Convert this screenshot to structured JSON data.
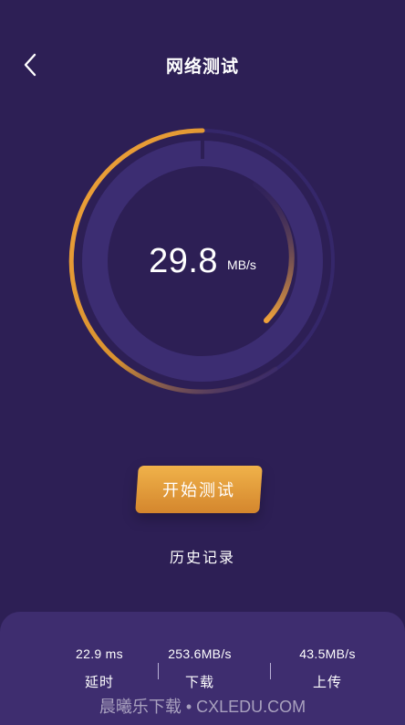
{
  "header": {
    "title": "网络测试",
    "back_icon": "chevron-left-icon"
  },
  "gauge": {
    "speed_value": "29.8",
    "speed_unit": "MB/s",
    "colors": {
      "accent": "#f0a23a",
      "track": "#3c2d6e",
      "background": "#2d1f55"
    }
  },
  "actions": {
    "start_label": "开始测试",
    "history_label": "历史记录"
  },
  "stats": [
    {
      "value": "22.9 ms",
      "label": "延时"
    },
    {
      "value": "253.6MB/s",
      "label": "下载"
    },
    {
      "value": "43.5MB/s",
      "label": "上传"
    }
  ],
  "watermark": "晨曦乐下载 • CXLEDU.COM"
}
